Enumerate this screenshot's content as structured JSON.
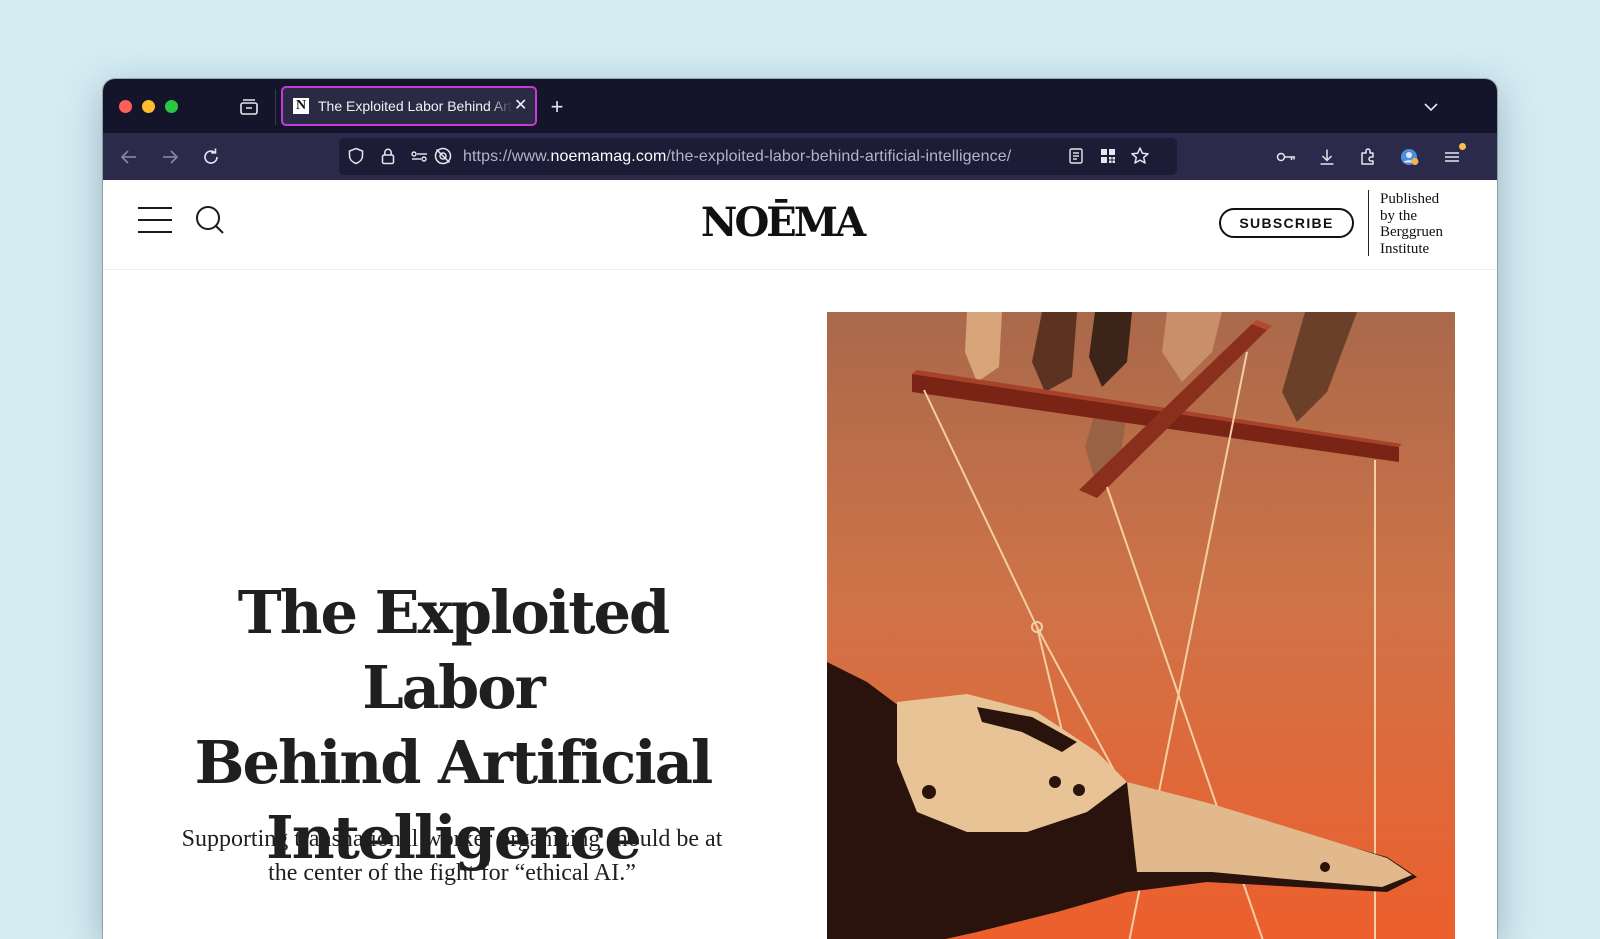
{
  "browser": {
    "tab": {
      "favicon_letter": "N",
      "title": "The Exploited Labor Behind Artificial Intelligence",
      "close_glyph": "✕"
    },
    "new_tab_glyph": "+",
    "url": {
      "scheme_prefix": "https://www.",
      "host": "noemamag.com",
      "path": "/the-exploited-labor-behind-artificial-intelligence/"
    },
    "icons": [
      "tab-view-icon",
      "back-arrow-icon",
      "forward-arrow-icon",
      "reload-icon",
      "shield-icon",
      "lock-icon",
      "permissions-icon",
      "tracking-blocked-icon",
      "reader-view-icon",
      "qr-code-icon",
      "bookmark-star-icon",
      "password-key-icon",
      "download-icon",
      "extensions-icon",
      "account-icon",
      "menu-icon",
      "list-tabs-chevron-icon"
    ],
    "colors": {
      "tab_strip": "#14142a",
      "toolbar": "#2b2a4a",
      "urlbar": "#1d1c36",
      "active_tab_border": "#c43bd6"
    }
  },
  "site": {
    "logo": "NOĒMA",
    "subscribe_label": "SUBSCRIBE",
    "publisher_lines": [
      "Published",
      "by the",
      "Berggruen",
      "Institute"
    ]
  },
  "article": {
    "headline_lines": [
      "The Exploited Labor",
      "Behind Artificial",
      "Intelligence"
    ],
    "dek_lines": [
      "Supporting transnational worker organizing should be at",
      "the center of the fight for “ethical AI.”"
    ]
  }
}
